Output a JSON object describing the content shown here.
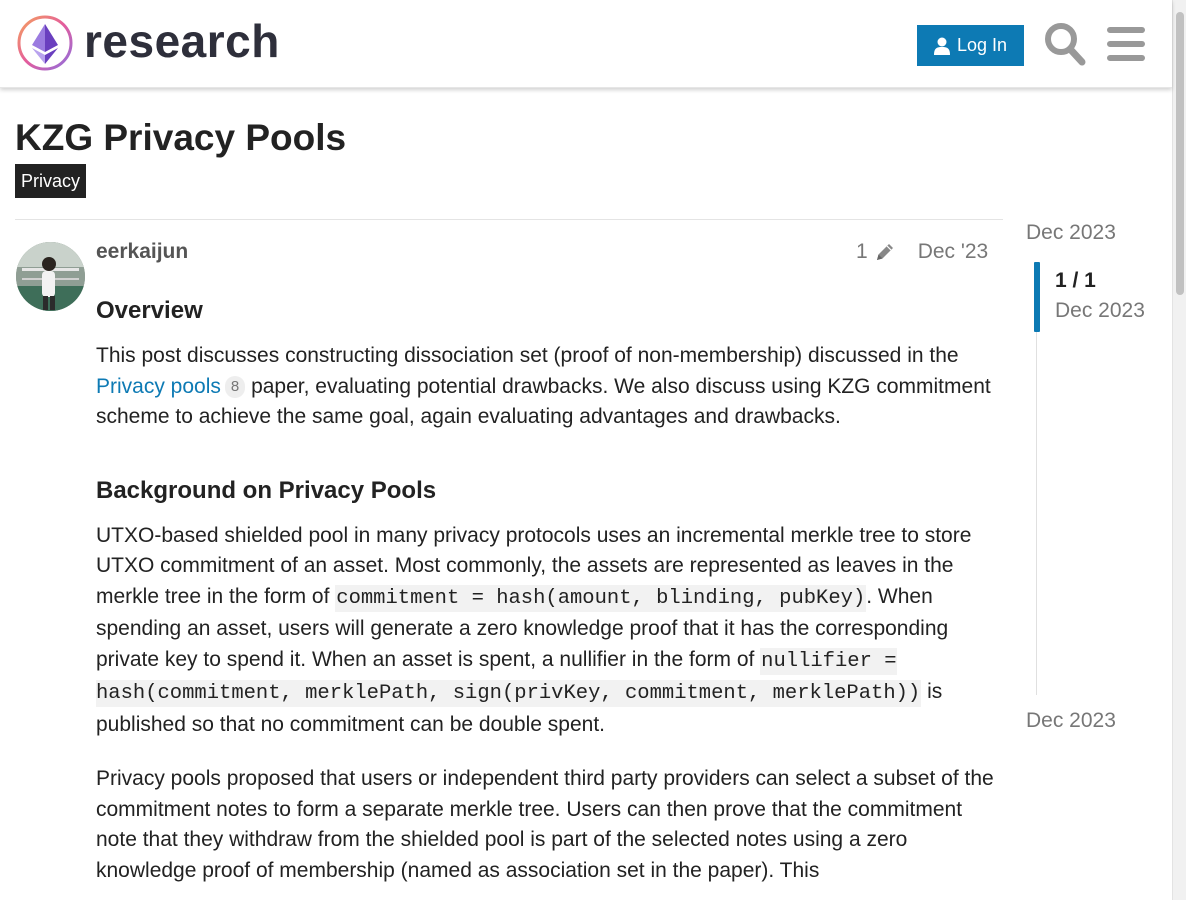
{
  "header": {
    "logo_text": "research",
    "login_label": "Log In",
    "colors": {
      "accent": "#0d7ab4",
      "logo_text": "#2e2f3b"
    },
    "icons": [
      "user-icon",
      "search-icon",
      "hamburger-menu-icon"
    ]
  },
  "topic": {
    "title": "KZG Privacy Pools",
    "category": "Privacy"
  },
  "post": {
    "username": "eerkaijun",
    "edit_count": "1",
    "date": "Dec '23",
    "h_overview": "Overview",
    "p1_before": "This post discusses constructing dissociation set (proof of non-membership) discussed in the ",
    "p1_link": "Privacy pools",
    "p1_link_clicks": "8",
    "p1_after": " paper, evaluating potential drawbacks. We also discuss using KZG commitment scheme to achieve the same goal, again evaluating advantages and drawbacks.",
    "h_background": "Background on Privacy Pools",
    "p2_a": "UTXO-based shielded pool in many privacy protocols uses an incremental merkle tree to store UTXO commitment of an asset. Most commonly, the assets are represented as leaves in the merkle tree in the form of ",
    "p2_code1": "commitment = hash(amount, blinding, pubKey)",
    "p2_b": ". When spending an asset, users will generate a zero knowledge proof that it has the corresponding private key to spend it. When an asset is spent, a nullifier in the form of ",
    "p2_code2": "nullifier = hash(commitment, merklePath, sign(privKey, commitment, merklePath))",
    "p2_c": " is published so that no commitment can be double spent.",
    "p3": "Privacy pools proposed that users or independent third party providers can select a subset of the commitment notes to form a separate merkle tree. Users can then prove that the commitment note that they withdraw from the shielded pool is part of the selected notes using a zero knowledge proof of membership (named as association set in the paper). This"
  },
  "timeline": {
    "start_date": "Dec 2023",
    "position": "1 / 1",
    "current_date": "Dec 2023",
    "end_date": "Dec 2023"
  }
}
